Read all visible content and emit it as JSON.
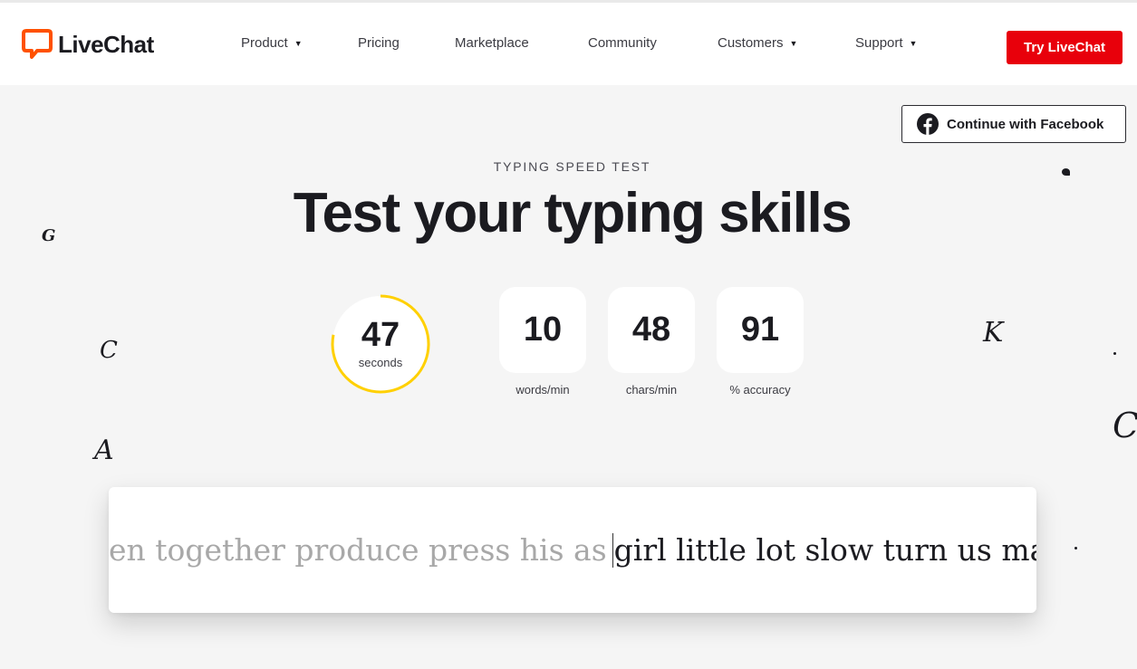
{
  "nav": {
    "logo_text": "LiveChat",
    "items": [
      {
        "label": "Product",
        "has_dropdown": true
      },
      {
        "label": "Pricing",
        "has_dropdown": false
      },
      {
        "label": "Marketplace",
        "has_dropdown": false
      },
      {
        "label": "Community",
        "has_dropdown": false
      },
      {
        "label": "Customers",
        "has_dropdown": true
      },
      {
        "label": "Support",
        "has_dropdown": true
      }
    ],
    "cta_label": "Try LiveChat",
    "caret": "▼"
  },
  "facebook": {
    "label": "Continue with Facebook",
    "icon": "facebook-icon"
  },
  "hero": {
    "kicker": "TYPING SPEED TEST",
    "title": "Test your typing skills"
  },
  "timer": {
    "value": "47",
    "unit": "seconds",
    "remaining_fraction": 0.78
  },
  "stats": [
    {
      "value": "10",
      "label": "words/min"
    },
    {
      "value": "48",
      "label": "chars/min"
    },
    {
      "value": "91",
      "label": "% accuracy"
    }
  ],
  "typing": {
    "typed_text": "en together produce press his as",
    "upcoming_text": "girl little lot slow turn us main w"
  },
  "decorations": [
    "G",
    "C",
    "A",
    "K",
    "C"
  ],
  "colors": {
    "brand_red": "#e8000b",
    "logo_orange": "#ff5100",
    "timer_ring": "#ffd000",
    "facebook_blue": "#1b1b20"
  }
}
